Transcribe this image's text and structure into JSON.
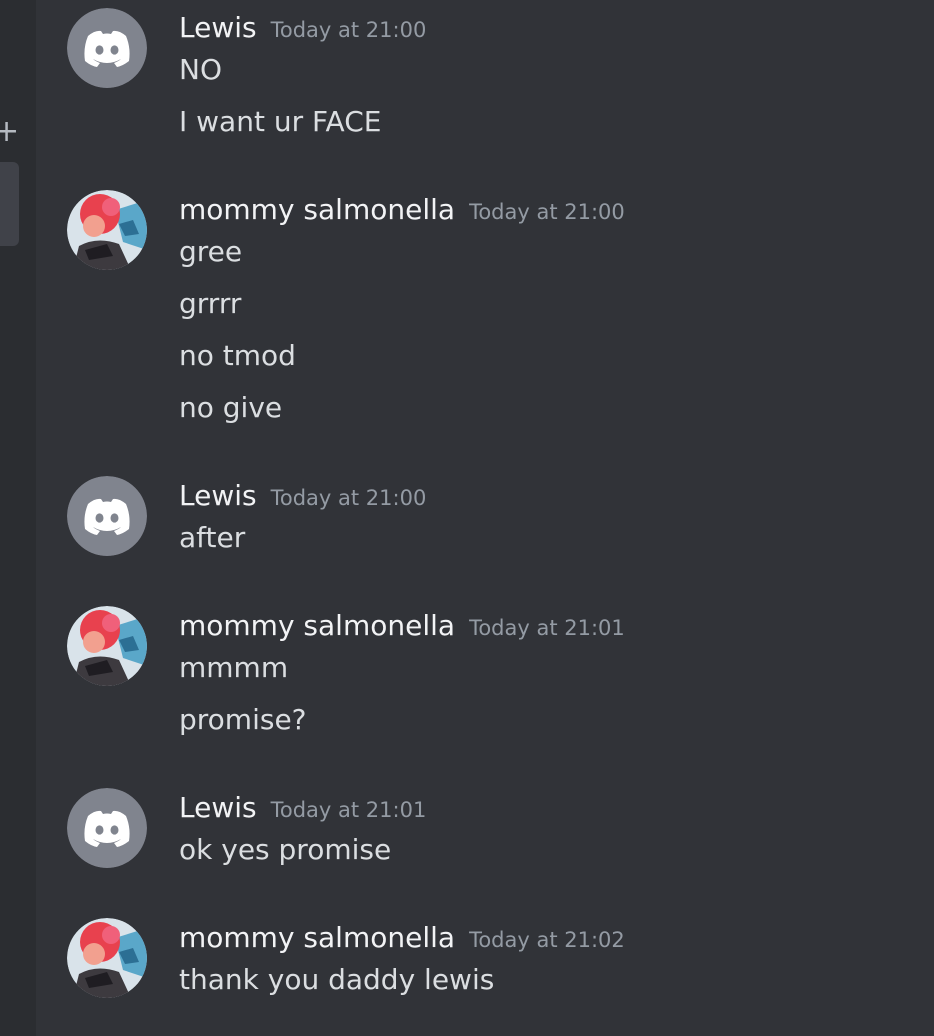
{
  "messages": [
    {
      "author": "Lewis",
      "avatar": "discord-default-avatar",
      "timestamp": "Today at 21:00",
      "lines": [
        "NO",
        "I want ur FACE"
      ]
    },
    {
      "author": "mommy salmonella",
      "avatar": "user-avatar",
      "timestamp": "Today at 21:00",
      "lines": [
        "gree",
        "grrrr",
        "no tmod",
        "no give"
      ]
    },
    {
      "author": "Lewis",
      "avatar": "discord-default-avatar",
      "timestamp": "Today at 21:00",
      "lines": [
        "after"
      ]
    },
    {
      "author": "mommy salmonella",
      "avatar": "user-avatar",
      "timestamp": "Today at 21:01",
      "lines": [
        "mmmm",
        "promise?"
      ]
    },
    {
      "author": "Lewis",
      "avatar": "discord-default-avatar",
      "timestamp": "Today at 21:01",
      "lines": [
        "ok yes promise"
      ]
    },
    {
      "author": "mommy salmonella",
      "avatar": "user-avatar",
      "timestamp": "Today at 21:02",
      "lines": [
        "thank you daddy lewis"
      ]
    }
  ],
  "sidebar": {
    "add_icon": "plus-icon"
  },
  "colors": {
    "background": "#313338",
    "rail": "#2b2d31",
    "username": "#f2f3f5",
    "timestamp": "#949ba4",
    "text": "#dbdee1",
    "default_avatar_bg": "#80848e"
  }
}
